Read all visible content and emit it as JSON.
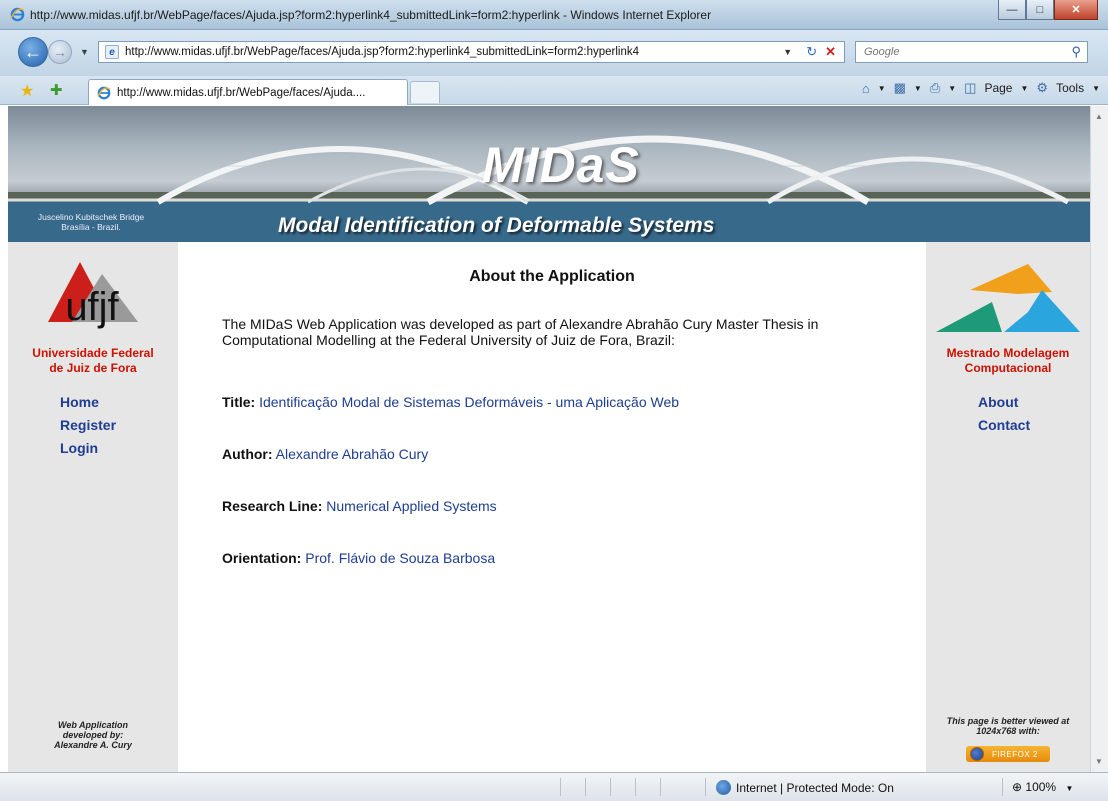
{
  "window": {
    "title": "http://www.midas.ufjf.br/WebPage/faces/Ajuda.jsp?form2:hyperlink4_submittedLink=form2:hyperlink - Windows Internet Explorer"
  },
  "address_bar": {
    "url": "http://www.midas.ufjf.br/WebPage/faces/Ajuda.jsp?form2:hyperlink4_submittedLink=form2:hyperlink4",
    "search_placeholder": "Google"
  },
  "tab": {
    "label": "http://www.midas.ufjf.br/WebPage/faces/Ajuda...."
  },
  "command_bar": {
    "page": "Page",
    "tools": "Tools"
  },
  "banner": {
    "title": "MIDaS",
    "subtitle": "Modal Identification of Deformable Systems",
    "caption_line1": "Juscelino Kubitschek Bridge",
    "caption_line2": "Brasília - Brazil."
  },
  "left": {
    "logo_text": "ufjf",
    "uni_line1": "Universidade Federal",
    "uni_line2": "de Juiz de Fora",
    "nav": [
      "Home",
      "Register",
      "Login"
    ],
    "footer_line1": "Web Application",
    "footer_line2": "developed by:",
    "footer_line3": "Alexandre A. Cury"
  },
  "right": {
    "prog_line1": "Mestrado Modelagem",
    "prog_line2": "Computacional",
    "nav": [
      "About",
      "Contact"
    ],
    "footer_line1": "This page is better viewed at",
    "footer_line2": "1024x768 with:",
    "badge": "FIREFOX 2"
  },
  "main": {
    "heading": "About the Application",
    "intro": "The MIDaS Web Application was developed as part of Alexandre Abrahão Cury Master Thesis in Computational Modelling at the Federal University of Juiz de Fora, Brazil:",
    "fields": [
      {
        "label": "Title:",
        "value": "Identificação Modal de Sistemas Deformáveis - uma Aplicação Web"
      },
      {
        "label": "Author:",
        "value": "Alexandre Abrahão Cury"
      },
      {
        "label": "Research Line:",
        "value": "Numerical Applied Systems"
      },
      {
        "label": "Orientation:",
        "value": "Prof. Flávio de Souza Barbosa"
      }
    ]
  },
  "status_bar": {
    "zone": "Internet | Protected Mode: On",
    "zoom": "100%"
  }
}
